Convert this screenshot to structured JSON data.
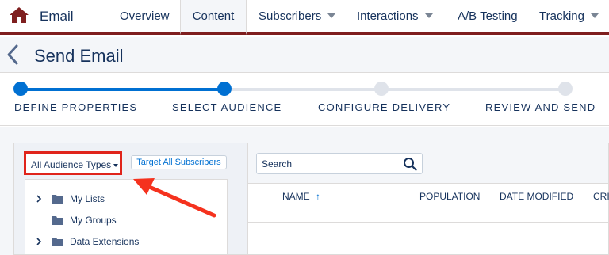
{
  "app": {
    "name": "Email",
    "icon": "home-icon"
  },
  "nav": {
    "tabs": [
      {
        "label": "Overview",
        "dropdown": false
      },
      {
        "label": "Content",
        "dropdown": false,
        "active": true
      },
      {
        "label": "Subscribers",
        "dropdown": true
      },
      {
        "label": "Interactions",
        "dropdown": true
      },
      {
        "label": "A/B Testing",
        "dropdown": false
      },
      {
        "label": "Tracking",
        "dropdown": true
      }
    ]
  },
  "header": {
    "title": "Send Email",
    "back_icon": "chevron-left-icon"
  },
  "progress": {
    "steps": [
      {
        "label": "DEFINE PROPERTIES",
        "state": "complete"
      },
      {
        "label": "SELECT AUDIENCE",
        "state": "current"
      },
      {
        "label": "CONFIGURE DELIVERY",
        "state": "incomplete"
      },
      {
        "label": "REVIEW AND SEND",
        "state": "incomplete"
      }
    ]
  },
  "audience": {
    "type_dropdown": "All Audience Types",
    "target_all_button": "Target All Subscribers",
    "tree": [
      {
        "label": "My Lists",
        "expandable": true
      },
      {
        "label": "My Groups",
        "expandable": false
      },
      {
        "label": "Data Extensions",
        "expandable": true
      }
    ]
  },
  "search": {
    "placeholder": "Search"
  },
  "table": {
    "columns": [
      "NAME",
      "POPULATION",
      "DATE MODIFIED",
      "CRI"
    ],
    "sort_indicator": "↑"
  },
  "colors": {
    "brand_dark_red": "#7f1f1f",
    "progress_blue": "#0070d2",
    "progress_gray": "#dfe3ea",
    "highlight_red": "#e0241b"
  }
}
